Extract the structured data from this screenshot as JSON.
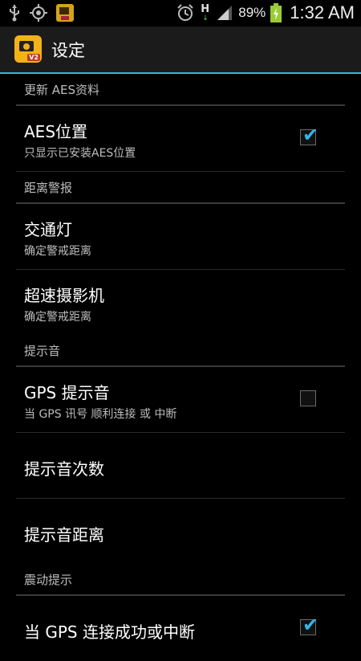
{
  "status_bar": {
    "battery_percent": "89%",
    "time": "1:32 AM",
    "network_type": "H",
    "icons": [
      "usb-icon",
      "gps-icon",
      "app-notification-icon",
      "alarm-icon",
      "network-h-icon",
      "signal-icon",
      "battery-charging-icon"
    ]
  },
  "action_bar": {
    "title": "设定",
    "app_badge": "V2"
  },
  "sections": {
    "aes_update": "更新 AES资料",
    "distance_alert": "距离警报",
    "alert_sound": "提示音",
    "vibration": "震动提示"
  },
  "prefs": {
    "aes_location": {
      "title": "AES位置",
      "summary": "只显示已安装AES位置",
      "checked": true
    },
    "traffic_light": {
      "title": "交通灯",
      "summary": "确定警戒距离"
    },
    "speed_camera": {
      "title": "超速摄影机",
      "summary": "确定警戒距离"
    },
    "gps_sound": {
      "title": "GPS 提示音",
      "summary": "当 GPS 讯号 顺利连接 或 中断",
      "checked": false
    },
    "sound_count": {
      "title": "提示音次数"
    },
    "sound_distance": {
      "title": "提示音距离"
    },
    "gps_vibrate": {
      "title": "当 GPS 连接成功或中断",
      "checked": true
    }
  },
  "colors": {
    "accent": "#33b5e5",
    "background": "#000000",
    "action_bar": "#1b1b1b",
    "secondary_text": "#bdbdbd"
  }
}
